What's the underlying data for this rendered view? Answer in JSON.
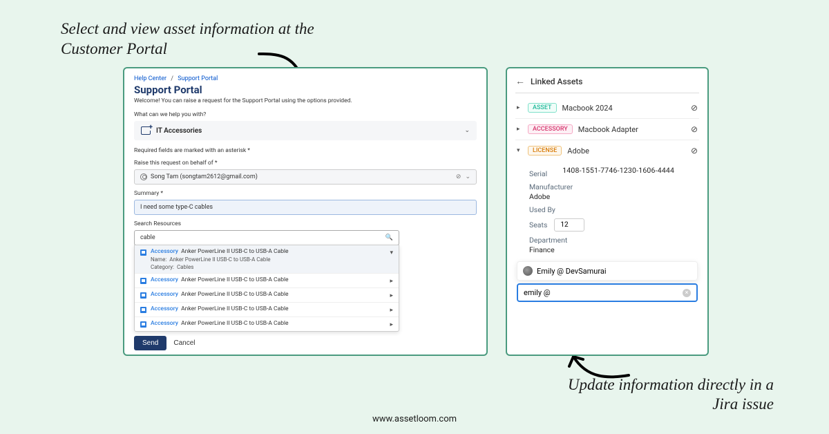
{
  "annotations": {
    "left": "Select and view asset information at the Customer Portal",
    "right": "Update information directly in a Jira issue"
  },
  "footer": {
    "url": "www.assetloom.com"
  },
  "portal": {
    "breadcrumb": {
      "a": "Help Center",
      "b": "Support Portal"
    },
    "title": "Support Portal",
    "welcome": "Welcome! You can raise a request for the Support Portal using the options provided.",
    "help_label": "What can we help you with?",
    "category": "IT Accessories",
    "required_note": "Required fields are marked with an asterisk *",
    "behalf_label": "Raise this request on behalf of *",
    "behalf_value": "Song Tam (songtam2612@gmail.com)",
    "summary_label": "Summary *",
    "summary_value": "I need some type-C cables",
    "search_label": "Search Resources",
    "search_value": "cable",
    "dropdown": {
      "badge": "Accessory",
      "item_title": "Anker PowerLine II USB-C to USB-A Cable",
      "name_label": "Name:",
      "name_value": "Anker PowerLine II USB-C to USB-A Cable",
      "cat_label": "Category:",
      "cat_value": "Cables"
    },
    "buttons": {
      "send": "Send",
      "cancel": "Cancel"
    }
  },
  "linked": {
    "title": "Linked Assets",
    "assets": [
      {
        "badge": "ASSET",
        "name": "Macbook 2024"
      },
      {
        "badge": "ACCESSORY",
        "name": "Macbook Adapter"
      },
      {
        "badge": "LICENSE",
        "name": "Adobe"
      }
    ],
    "detail": {
      "serial_label": "Serial",
      "serial_value": "1408-1551-7746-1230-1606-4444",
      "manufacturer_label": "Manufacturer",
      "manufacturer_value": "Adobe",
      "usedby_label": "Used By",
      "seats_label": "Seats",
      "seats_value": "12",
      "department_label": "Department",
      "department_value": "Finance"
    },
    "user_suggest": "Emily @ DevSamurai",
    "user_search": "emily @"
  }
}
